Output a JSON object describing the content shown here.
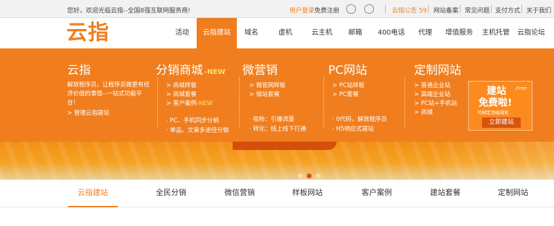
{
  "topbar": {
    "welcome": "您好，欢迎光临云指--全国8强互联网服务商!",
    "login": "用户登录",
    "register": "免费注册",
    "notice_label": "云指公告",
    "notice_count": "59",
    "links": [
      "网站备案",
      "常见问题",
      "支付方式",
      "关于我们"
    ]
  },
  "header": {
    "logo": "云指",
    "nav": [
      "活动",
      "云指建站",
      "域名",
      "虚机",
      "云主机",
      "邮箱",
      "400电话",
      "代理",
      "增值服务",
      "主机托管",
      "云指论坛"
    ],
    "active_nav": "云指建站"
  },
  "mega": {
    "col1": {
      "title": "云指",
      "desc": "解放程序员，让程序员做更有经济价值的事情--一站式功能平台！",
      "link": "> 管理云指建站"
    },
    "col2": {
      "title": "分销商城",
      "badge": "-NEW",
      "links": [
        "> 商城样板",
        "> 商城套餐",
        "> 客户案例"
      ],
      "link_badge": "-NEW",
      "notes": [
        "· PC、手机同步分销",
        "· 单品、文章多途径分销"
      ]
    },
    "col3": {
      "title": "微营销",
      "links": [
        "> 微官网样板",
        "> 微站套餐"
      ],
      "notes": [
        "· 吸粉：引爆流量",
        "· 转化：线上线下打通"
      ]
    },
    "col4": {
      "title": "PC网站",
      "links": [
        "> PC站样板",
        "> PC套餐"
      ],
      "notes": [
        "· 0代码，解放程序员",
        "· H5响应式建站"
      ]
    },
    "col5": {
      "title": "定制网站",
      "links": [
        "> 普通企业站",
        "> 高端企业站",
        "> PC站+手机站",
        "> 商城"
      ]
    },
    "promo": {
      "line1": "建站",
      "free_en": "Free",
      "line2": "免费啦!",
      "small": "可绑定顶级域名",
      "button": "立即建站"
    }
  },
  "banner": {
    "slides": 3,
    "active_slide": 2
  },
  "subnav": {
    "items": [
      "云指建站",
      "全民分销",
      "微信营销",
      "样板网站",
      "客户案例",
      "建站套餐",
      "定制网站"
    ],
    "active": "云指建站"
  },
  "colors": {
    "brand": "#f07e1e",
    "dark_orange": "#d9540a",
    "highlight": "#ffe06b"
  }
}
